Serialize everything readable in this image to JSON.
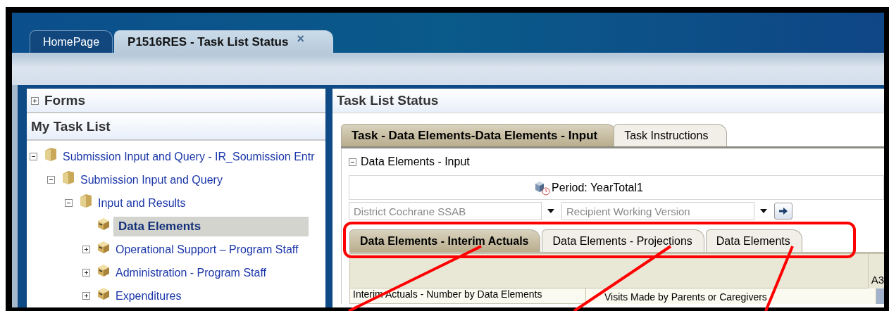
{
  "app_tabs": [
    {
      "label": "HomePage",
      "selected": false
    },
    {
      "label": "P1516RES - Task List Status",
      "selected": true,
      "close": "×"
    }
  ],
  "left_panel": {
    "forms": {
      "label": "Forms",
      "expanded": false
    },
    "task_list_title": "My Task List",
    "tree": [
      {
        "label": "Submission Input and Query - IR_Soumission Entr",
        "kind": "folder",
        "expanded": true,
        "selected": false,
        "children": [
          {
            "label": "Submission Input and Query",
            "kind": "folder",
            "expanded": true,
            "selected": false,
            "children": [
              {
                "label": "Input and Results",
                "kind": "folder",
                "expanded": true,
                "selected": false,
                "children": [
                  {
                    "label": "Data Elements",
                    "kind": "task",
                    "selected": true
                  },
                  {
                    "label": "Operational Support – Program Staff",
                    "kind": "task",
                    "expanded": false,
                    "selected": false
                  },
                  {
                    "label": "Administration - Program Staff",
                    "kind": "task",
                    "expanded": false,
                    "selected": false
                  },
                  {
                    "label": "Expenditures",
                    "kind": "task",
                    "expanded": false,
                    "selected": false
                  }
                ]
              }
            ]
          }
        ]
      }
    ]
  },
  "right_panel": {
    "title": "Task List Status",
    "task_tabs": [
      {
        "label": "Task - Data Elements-Data Elements - Input",
        "selected": true
      },
      {
        "label": "Task Instructions",
        "selected": false
      }
    ],
    "section": {
      "label": "Data Elements - Input",
      "expanded": true
    },
    "period": "Period: YearTotal1",
    "selectors": [
      {
        "value": "District Cochrane SSAB"
      },
      {
        "value": "Recipient Working Version"
      }
    ],
    "form_tabs": [
      {
        "label": "Data Elements - Interim Actuals",
        "selected": true
      },
      {
        "label": "Data Elements - Projections",
        "selected": false
      },
      {
        "label": "Data Elements",
        "selected": false
      }
    ],
    "grid": {
      "column_header": "A3",
      "row_header": "Interim Actuals - Number by Data Elements",
      "cell": "Visits Made by Parents or Caregivers"
    }
  }
}
